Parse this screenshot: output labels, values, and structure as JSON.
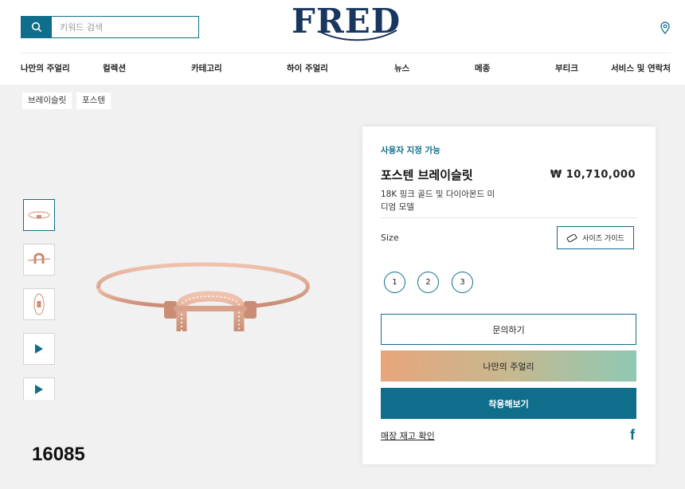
{
  "search": {
    "placeholder": "키워드 검색",
    "icon": "search-icon"
  },
  "logo": "FRED",
  "header": {
    "store_icon": "location-pin-icon"
  },
  "nav": [
    "나만의 주얼리",
    "컬렉션",
    "카테고리",
    "하이 주얼리",
    "뉴스",
    "메종",
    "부티크",
    "서비스 및 연락처"
  ],
  "breadcrumb": [
    "브레이슬릿",
    "포스텐"
  ],
  "gallery": {
    "thumbnails": [
      "image",
      "image",
      "image",
      "video",
      "video"
    ],
    "active_index": 0
  },
  "reference_number": "16085",
  "product": {
    "customizable": "사용자 지정 가능",
    "name": "포스텐 브레이슬릿",
    "price": "₩ 10,710,000",
    "description": "18K 핑크 골드 및 다이아몬드 미디엄 모델",
    "size_label": "Size",
    "size_guide": "사이즈 가이드",
    "sizes": [
      "1",
      "2",
      "3"
    ],
    "inquiry_button": "문의하기",
    "my_jewelry_button": "나만의 주얼리",
    "try_on_button": "착용해보기",
    "stock_link": "매장 재고 확인",
    "share_icon": "facebook-icon"
  },
  "colors": {
    "accent": "#0f6e8c",
    "logo": "#18365e",
    "metal": "#d9a18a"
  }
}
